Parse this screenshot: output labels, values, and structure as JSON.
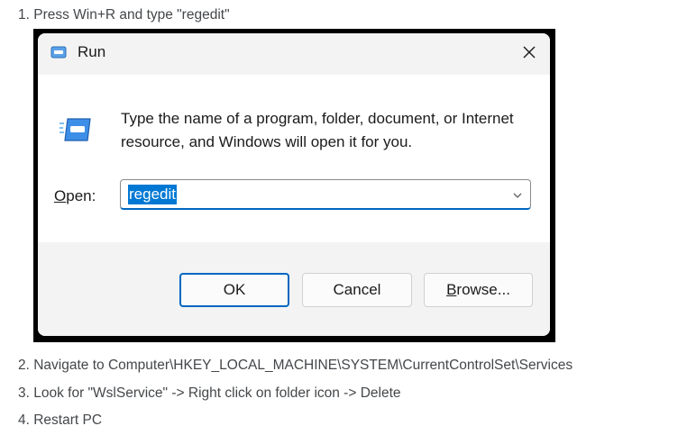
{
  "instructions": {
    "step1": "1. Press Win+R and type \"regedit\"",
    "step2": "2. Navigate to Computer\\HKEY_LOCAL_MACHINE\\SYSTEM\\CurrentControlSet\\Services",
    "step3": "3. Look for \"WslService\" -> Right click on folder icon -> Delete",
    "step4": "4. Restart PC"
  },
  "dialog": {
    "title": "Run",
    "title_icon": "run-icon",
    "close_icon": "close-icon",
    "description": "Type the name of a program, folder, document, or Internet resource, and Windows will open it for you.",
    "open_label_first": "O",
    "open_label_rest": "pen:",
    "input_value": "regedit",
    "dropdown_icon": "chevron-down-icon",
    "buttons": {
      "ok": "OK",
      "cancel": "Cancel",
      "browse_first": "B",
      "browse_rest": "rowse..."
    }
  },
  "colors": {
    "accent": "#0067c0",
    "selection": "#0078d4",
    "dialog_bg": "#f3f3f3",
    "content_bg": "#ffffff",
    "frame": "#000000"
  }
}
